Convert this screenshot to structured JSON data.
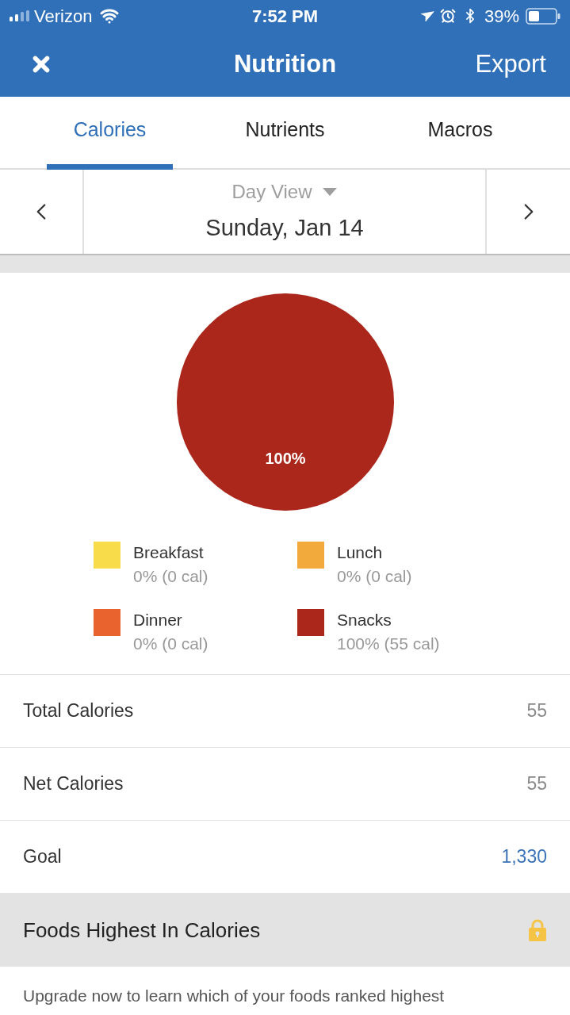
{
  "status_bar": {
    "carrier": "Verizon",
    "time": "7:52 PM",
    "battery": "39%"
  },
  "nav_bar": {
    "title": "Nutrition",
    "action": "Export"
  },
  "tabs": [
    {
      "label": "Calories",
      "selected": true
    },
    {
      "label": "Nutrients",
      "selected": false
    },
    {
      "label": "Macros",
      "selected": false
    }
  ],
  "date_picker": {
    "view": "Day View",
    "date": "Sunday, Jan 14"
  },
  "chart": {
    "chart_data": {
      "type": "pie",
      "categories": [
        "Breakfast",
        "Lunch",
        "Dinner",
        "Snacks"
      ],
      "values": [
        0,
        0,
        0,
        100
      ],
      "value_labels": [
        null,
        null,
        null,
        "100%"
      ]
    },
    "legend": [
      {
        "detail": "0% (0 cal)",
        "color": "#f9dc4a"
      },
      {
        "detail": "0% (0 cal)",
        "color": "#f2aa3c"
      },
      {
        "detail": "0% (0 cal)",
        "color": "#e8632e"
      },
      {
        "detail": "100% (55 cal)",
        "color": "#ab261b"
      }
    ]
  },
  "summary": [
    {
      "label": "Total Calories",
      "value": "55",
      "kind": "plain"
    },
    {
      "label": "Net Calories",
      "value": "55",
      "kind": "plain"
    },
    {
      "label": "Goal",
      "value": "1,330",
      "kind": "link"
    }
  ],
  "locked_section": {
    "title": "Foods Highest In Calories",
    "locked": true,
    "message": "Upgrade now to learn which of your foods ranked highest"
  }
}
